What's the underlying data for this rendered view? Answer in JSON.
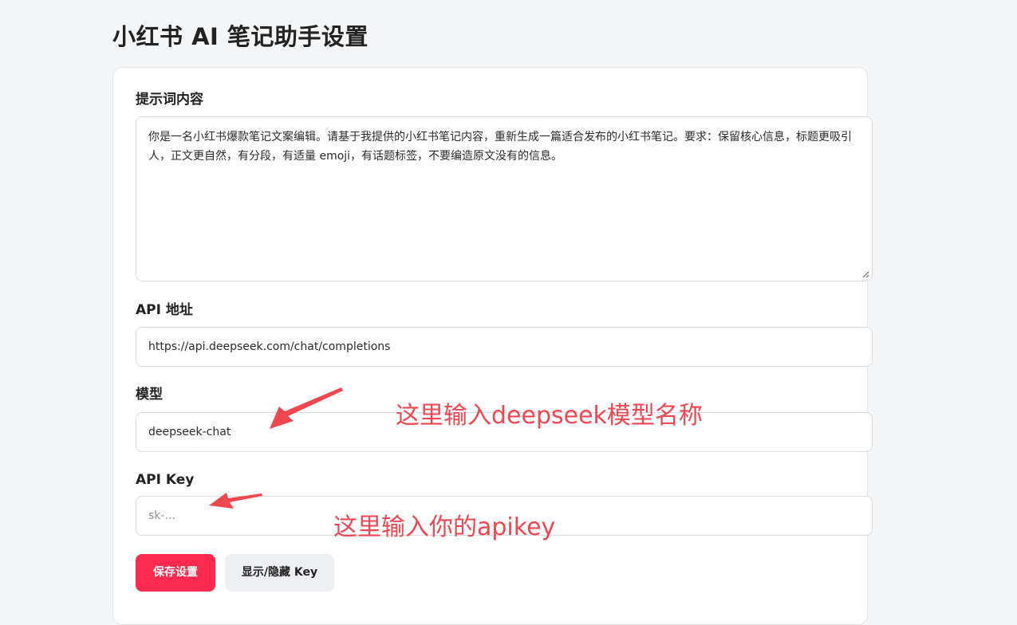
{
  "page": {
    "title": "小红书 AI 笔记助手设置"
  },
  "form": {
    "prompt": {
      "label": "提示词内容",
      "value": "你是一名小红书爆款笔记文案编辑。请基于我提供的小红书笔记内容，重新生成一篇适合发布的小红书笔记。要求：保留核心信息，标题更吸引人，正文更自然，有分段，有适量 emoji，有话题标签，不要编造原文没有的信息。"
    },
    "api_url": {
      "label": "API 地址",
      "value": "https://api.deepseek.com/chat/completions"
    },
    "model": {
      "label": "模型",
      "value": "deepseek-chat"
    },
    "api_key": {
      "label": "API Key",
      "value": "",
      "placeholder": "sk-..."
    }
  },
  "buttons": {
    "save_label": "保存设置",
    "toggle_key_label": "显示/隐藏 Key"
  },
  "annotations": {
    "model_note": "这里输入deepseek模型名称",
    "key_note": "这里输入你的apikey"
  },
  "colors": {
    "accent": "#ff2a4f",
    "annotation": "#f0464f",
    "background": "#f4f5f7"
  }
}
